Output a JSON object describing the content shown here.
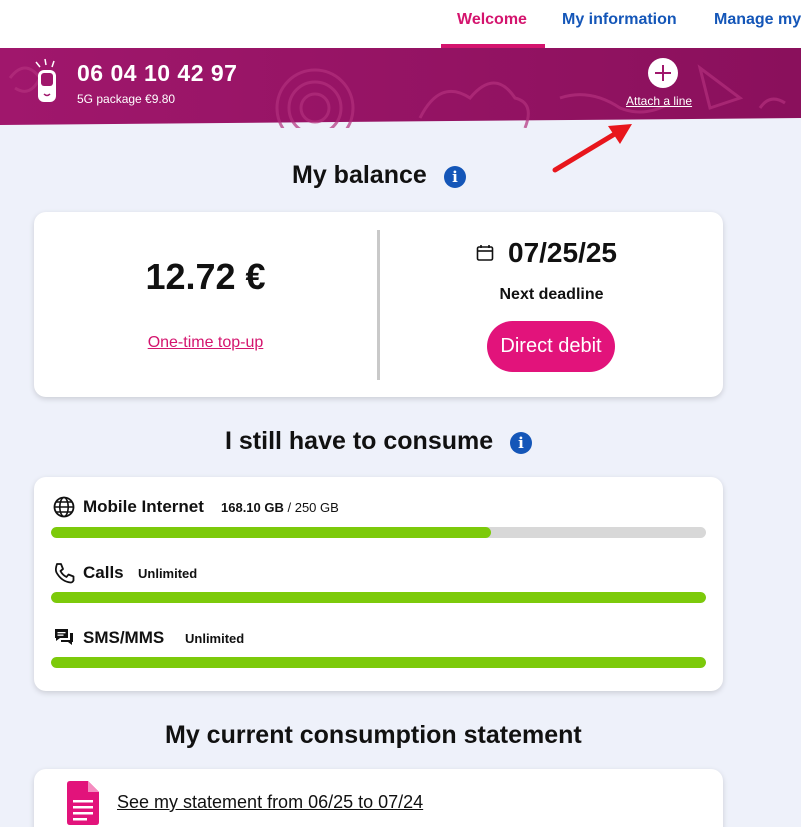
{
  "nav": {
    "tabs": [
      {
        "label": "Welcome",
        "active": true
      },
      {
        "label": "My information",
        "active": false
      },
      {
        "label": "Manage my",
        "active": false
      }
    ]
  },
  "line": {
    "number": "06 04 10 42 97",
    "package": "5G package €9.80",
    "attach_label": "Attach a line"
  },
  "balance": {
    "title": "My balance",
    "amount": "12.72 €",
    "topup_label": "One-time top-up",
    "deadline_date": "07/25/25",
    "deadline_label": "Next deadline",
    "debit_label": "Direct debit"
  },
  "consume": {
    "title": "I still have to consume",
    "rows": [
      {
        "label": "Mobile Internet",
        "used": "168.10 GB",
        "total": "/ 250 GB",
        "fraction": 0.672
      },
      {
        "label": "Calls",
        "status": "Unlimited",
        "fraction": 1
      },
      {
        "label": "SMS/MMS",
        "status": "Unlimited",
        "fraction": 1
      }
    ]
  },
  "statement": {
    "title": "My current consumption statement",
    "link_label": "See my statement from 06/25 to 07/24"
  },
  "colors": {
    "brand_magenta": "#d4146e",
    "nav_blue": "#1456b8",
    "banner": "#9c1468",
    "progress_green": "#7cca0a"
  }
}
